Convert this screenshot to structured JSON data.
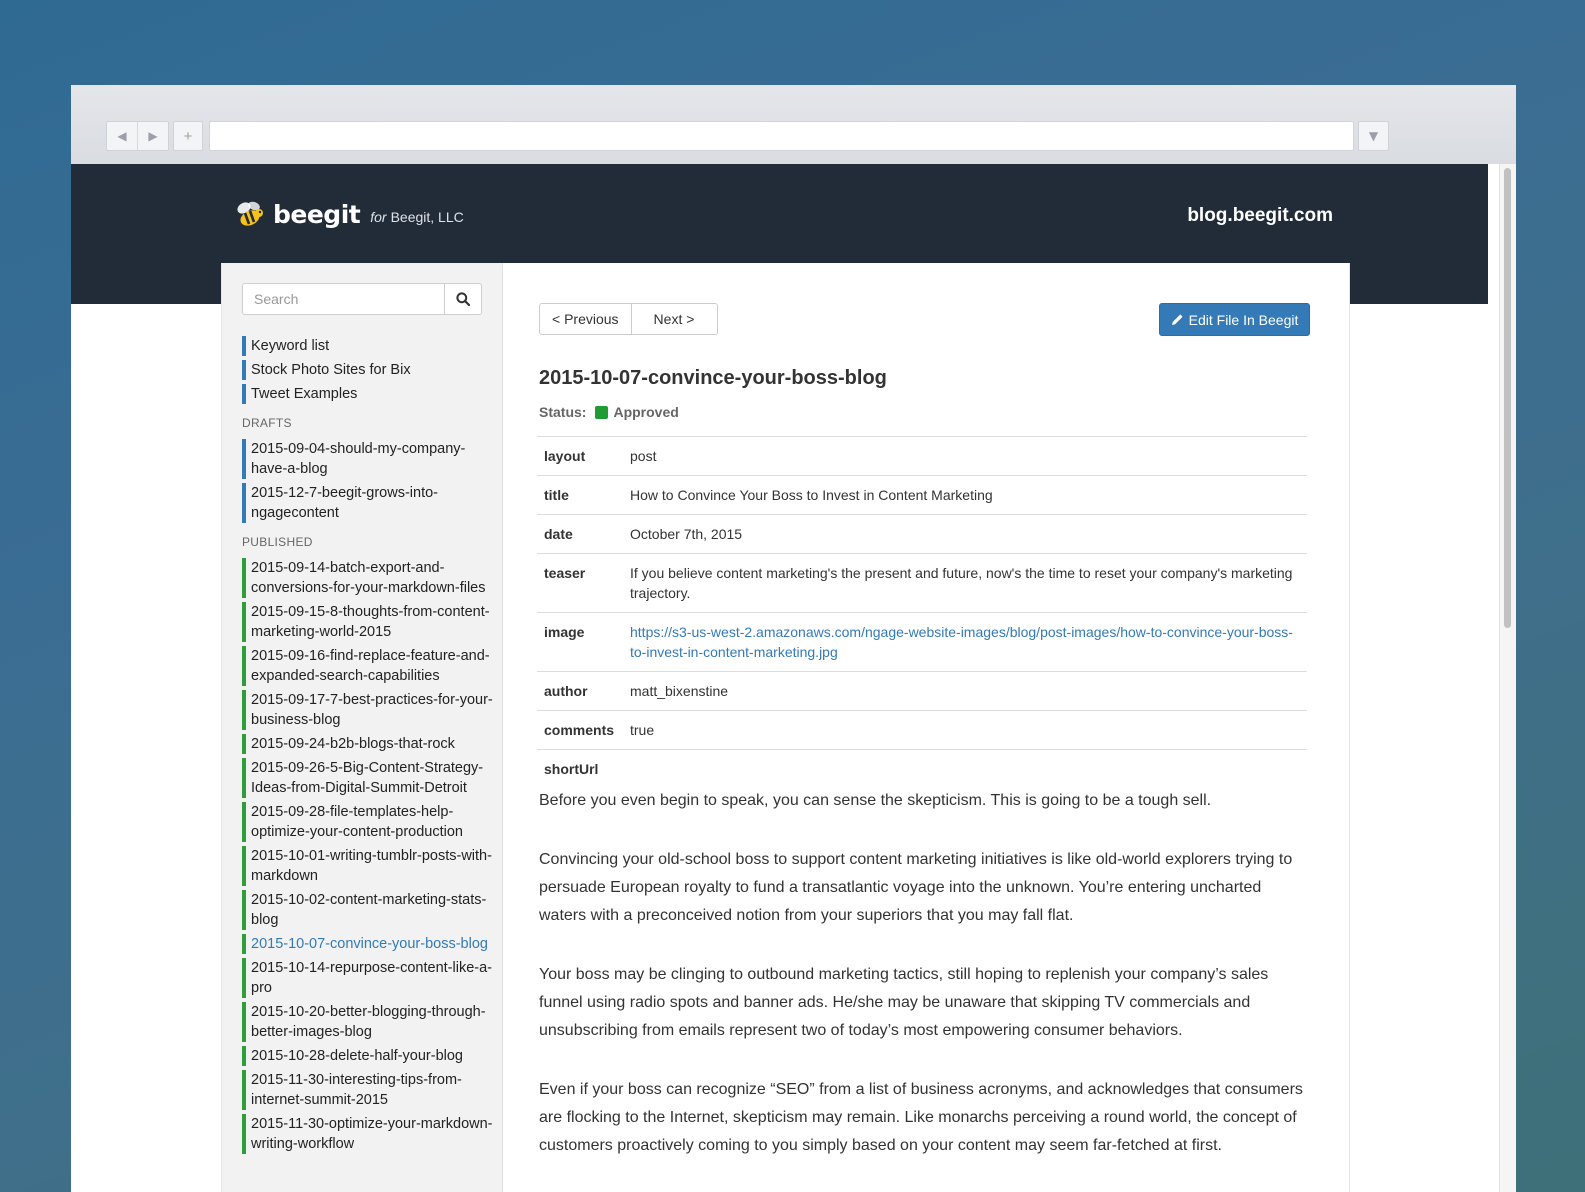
{
  "browser": {
    "back_glyph": "◀",
    "forward_glyph": "▶",
    "new_tab_glyph": "+",
    "menu_glyph": "▼",
    "url": ""
  },
  "header": {
    "logo_text": "beegit",
    "logo_for": "for",
    "org": "Beegit, LLC",
    "site_domain": "blog.beegit.com",
    "colors": {
      "background": "#222b38",
      "accent": "#337ab7",
      "published": "#2f9e3a",
      "approved": "#1f9d34"
    }
  },
  "sidebar": {
    "search_placeholder": "Search",
    "pinned": [
      "Keyword list",
      "Stock Photo Sites for Bix",
      "Tweet Examples"
    ],
    "drafts_label": "DRAFTS",
    "drafts": [
      "2015-09-04-should-my-company-have-a-blog",
      "2015-12-7-beegit-grows-into-ngagecontent"
    ],
    "published_label": "PUBLISHED",
    "published": [
      "2015-09-14-batch-export-and-conversions-for-your-markdown-files",
      "2015-09-15-8-thoughts-from-content-marketing-world-2015",
      "2015-09-16-find-replace-feature-and-expanded-search-capabilities",
      "2015-09-17-7-best-practices-for-your-business-blog",
      "2015-09-24-b2b-blogs-that-rock",
      "2015-09-26-5-Big-Content-Strategy-Ideas-from-Digital-Summit-Detroit",
      "2015-09-28-file-templates-help-optimize-your-content-production",
      "2015-10-01-writing-tumblr-posts-with-markdown",
      "2015-10-02-content-marketing-stats-blog",
      "2015-10-07-convince-your-boss-blog",
      "2015-10-14-repurpose-content-like-a-pro",
      "2015-10-20-better-blogging-through-better-images-blog",
      "2015-10-28-delete-half-your-blog",
      "2015-11-30-interesting-tips-from-internet-summit-2015",
      "2015-11-30-optimize-your-markdown-writing-workflow"
    ],
    "active": "2015-10-07-convince-your-boss-blog"
  },
  "main": {
    "prev_label": "< Previous",
    "next_label": "Next >",
    "edit_label": "Edit File In Beegit",
    "title": "2015-10-07-convince-your-boss-blog",
    "status_label": "Status:",
    "status_value": "Approved",
    "front_matter": [
      {
        "key": "layout",
        "value": "post"
      },
      {
        "key": "title",
        "value": "How to Convince Your Boss to Invest in Content Marketing"
      },
      {
        "key": "date",
        "value": "October 7th, 2015"
      },
      {
        "key": "teaser",
        "value": "If you believe content marketing's the present and future, now's the time to reset your company's marketing trajectory."
      },
      {
        "key": "image",
        "value": "https://s3-us-west-2.amazonaws.com/ngage-website-images/blog/post-images/how-to-convince-your-boss-to-invest-in-content-marketing.jpg",
        "link": true
      },
      {
        "key": "author",
        "value": "matt_bixenstine"
      },
      {
        "key": "comments",
        "value": "true"
      },
      {
        "key": "shortUrl",
        "value": ""
      }
    ],
    "paragraphs": [
      "Before you even begin to speak, you can sense the skepticism. This is going to be a tough sell.",
      "Convincing your old-school boss to support content marketing initiatives is like old-world explorers trying to persuade European royalty to fund a transatlantic voyage into the unknown. You’re entering uncharted waters with a preconceived notion from your superiors that you may fall flat.",
      "Your boss may be clinging to outbound marketing tactics, still hoping to replenish your company’s sales funnel using radio spots and banner ads. He/she may be unaware that skipping TV commercials and unsubscribing from emails represent two of today’s most empowering consumer behaviors.",
      "Even if your boss can recognize “SEO” from a list of business acronyms, and acknowledges that consumers are flocking to the Internet, skepticism may remain. Like monarchs perceiving a round world, the concept of customers proactively coming to you simply based on your content may seem far-fetched at first."
    ]
  }
}
